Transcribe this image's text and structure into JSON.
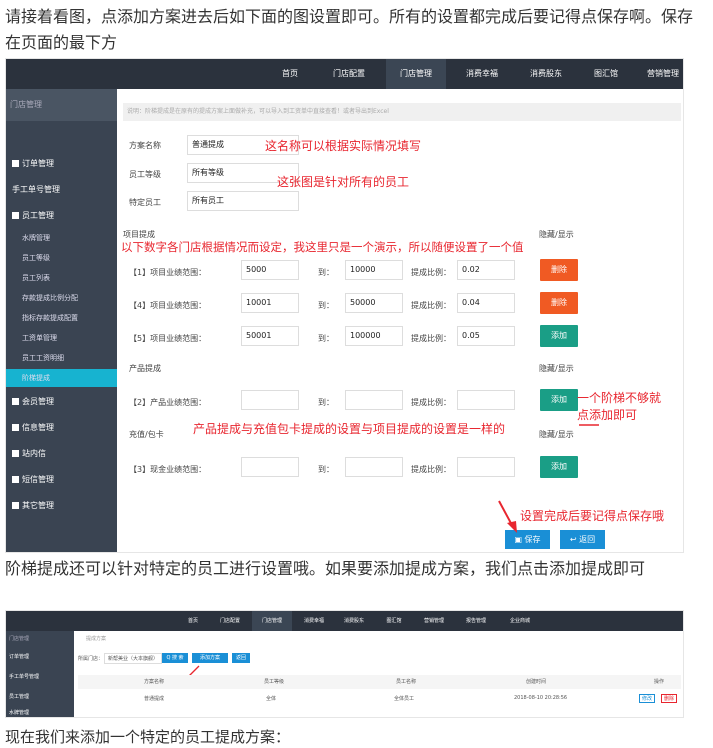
{
  "paragraphs": {
    "p1": "请接着看图，点添加方案进去后如下面的图设置即可。所有的设置都完成后要记得点保存啊。保存在页面的最下方",
    "p2": "阶梯提成还可以针对特定的员工进行设置哦。如果要添加提成方案，我们点击添加提成即可",
    "p3": "现在我们来添加一个特定的员工提成方案："
  },
  "shot1": {
    "topnav": [
      "首页",
      "门店配置",
      "门店管理",
      "消费幸福",
      "消费股东",
      "图汇馆",
      "营销管理"
    ],
    "sidebar": {
      "head": "门店管理",
      "items": [
        "订单管理",
        "手工单号管理",
        "员工管理",
        "水牌管理",
        "员工等级",
        "员工列表",
        "存款提成比例分配",
        "指标存款提成配置",
        "工资单管理",
        "员工工资明细",
        "阶梯提成",
        "会员管理",
        "信息管理",
        "站内信",
        "短信管理",
        "其它管理"
      ]
    },
    "notice": "说明：阶梯提成是在原有的提成方案上面做补充，可以导入到工资单中直接查看！或者导出到Excel",
    "form": {
      "scheme_label": "方案名称",
      "scheme_value": "普通提成",
      "level_label": "员工等级",
      "level_value": "所有等级",
      "staff_label": "特定员工",
      "staff_value": "所有员工",
      "project_title": "项目提成",
      "product_title": "产品提成",
      "recharge_title": "充值/包卡",
      "toggle": "隐藏/显示",
      "to": "到：",
      "ratio": "提成比例：",
      "rows": [
        {
          "label": "【1】项目业绩范围：",
          "from": "5000",
          "to": "10000",
          "ratio": "0.02",
          "btn": "删除"
        },
        {
          "label": "【4】项目业绩范围：",
          "from": "10001",
          "to": "50000",
          "ratio": "0.04",
          "btn": "删除"
        },
        {
          "label": "【5】项目业绩范围：",
          "from": "50001",
          "to": "100000",
          "ratio": "0.05",
          "btn": "添加"
        }
      ],
      "product_row": {
        "label": "【2】产品业绩范围：",
        "btn": "添加"
      },
      "recharge_row": {
        "label": "【3】现金业绩范围：",
        "btn": "添加"
      },
      "save": "保存",
      "back": "返回"
    },
    "annotations": {
      "a1": "这名称可以根据实际情况填写",
      "a2": "这张图是针对所有的员工",
      "a3": "以下数字各门店根据情况而设定，我这里只是一个演示，所以随便设置了一个值",
      "a4": "一个阶梯不够就",
      "a5": "点添加即可",
      "a6": "产品提成与充值包卡提成的设置与项目提成的设置是一样的",
      "a7": "设置完成后要记得点保存哦"
    }
  },
  "shot2": {
    "topnav": [
      "首页",
      "门店配置",
      "门店管理",
      "消费幸福",
      "消费股东",
      "图汇馆",
      "营销管理",
      "报告管理",
      "企业商城"
    ],
    "sidebar": [
      "门店管理",
      "订单管理",
      "手工单号管理",
      "员工管理",
      "水牌管理"
    ],
    "crumb": "提成方案",
    "filter_label": "所属门店：",
    "filter_value": "新帮美业（大本旗舰）",
    "search": "Q 搜 索",
    "add": "添加方案",
    "ret": "返回",
    "columns": [
      "方案名称",
      "员工等级",
      "员工名称",
      "创建时间",
      "操作"
    ],
    "row": [
      "普通提成",
      "全体",
      "全体员工",
      "2018-08-10 20:28:56",
      "修改",
      "删除"
    ]
  },
  "colors": {
    "nav": "#2b323d",
    "sidebar": "#3a4452",
    "highlight": "#17b3d0",
    "red": "#f05a23",
    "teal": "#1a9e86",
    "annotation": "#e8262f",
    "blue": "#1a8fd6"
  }
}
